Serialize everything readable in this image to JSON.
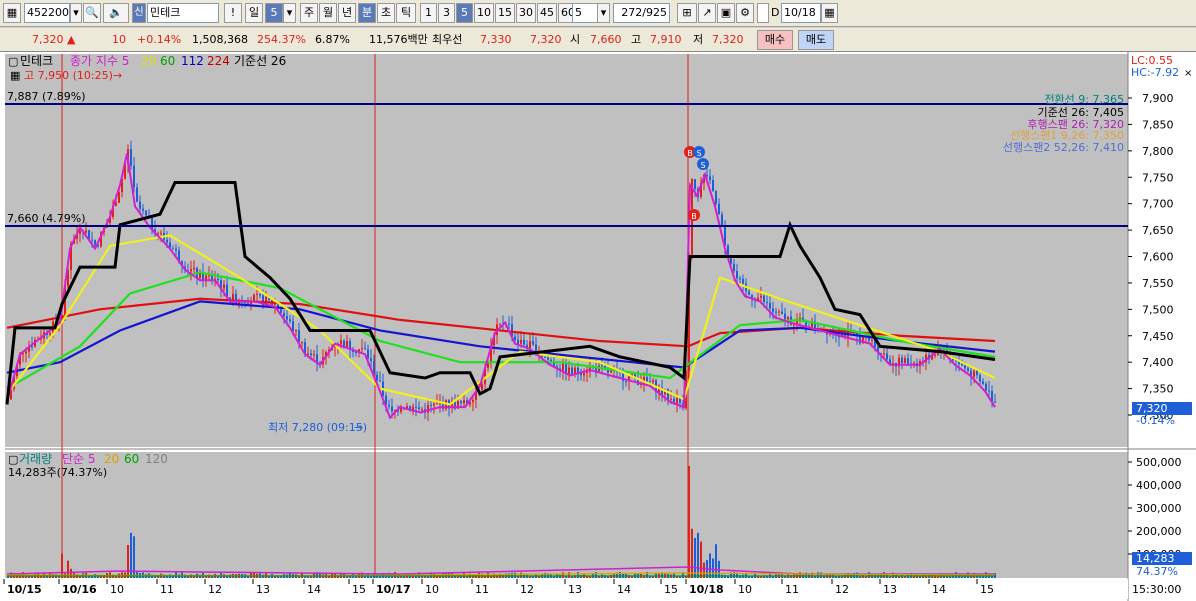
{
  "toolbar": {
    "code": "452200",
    "name": "민테크",
    "shin": "신",
    "btn_excl": "!",
    "period": "일",
    "period_n": "5",
    "week": "주",
    "month": "월",
    "year": "년",
    "minute": "분",
    "second": "초",
    "tick": "틱",
    "n1": "1",
    "n3": "3",
    "n5": "5",
    "n10": "10",
    "n15": "15",
    "n30": "30",
    "n45": "45",
    "n60": "60",
    "count": "5",
    "paging": "272/925",
    "chk_d": "D",
    "date": "10/18"
  },
  "quote": {
    "price": "7,320 ▲",
    "change": "10",
    "rate": "+0.14%",
    "volume": "1,508,368",
    "vol_ratio": "254.37%",
    "turnover": "6.87%",
    "amount": "11,576백만",
    "best_label": "최우선",
    "best_ask": "7,330",
    "best_bid": "7,320",
    "open_label": "시",
    "open": "7,660",
    "high_label": "고",
    "high": "7,910",
    "low_label": "저",
    "low": "7,320",
    "buy": "매수",
    "sell": "매도"
  },
  "legend": {
    "name": "민테크",
    "ma_label": "종가 지수 5",
    "ma20": "20",
    "ma60": "60",
    "ma112": "112",
    "ma224": "224",
    "base": "기준선 26",
    "high_mark": "고 7,950 (10:25)"
  },
  "lines": {
    "l1": "7,887 (7.89%)",
    "l2": "7,660 (4.79%)"
  },
  "lowmark": "최저 7,280 (09:15)",
  "ichimoku": {
    "conv": "전환선 9: 7,365",
    "base": "기준선 26: 7,405",
    "lag": "후행스팬 26: 7,320",
    "lead1": "선행스팬1 9,26: 7,350",
    "lead2": "선행스팬2 52,26: 7,410"
  },
  "lc": "LC:0.55",
  "hc": "HC:-7.92",
  "price_axis": [
    "7,900",
    "7,850",
    "7,800",
    "7,750",
    "7,700",
    "7,650",
    "7,600",
    "7,550",
    "7,500",
    "7,450",
    "7,400",
    "7,350",
    "7,300"
  ],
  "current": {
    "price": "7,320",
    "rate": "-0.14%"
  },
  "vol_legend": {
    "label": "거래량",
    "simple": "단순 5",
    "v20": "20",
    "v60": "60",
    "v120": "120",
    "value": "14,283주(74.37%)"
  },
  "vol_axis": [
    "500,000",
    "400,000",
    "300,000",
    "200,000",
    "100,000"
  ],
  "vol_current": {
    "value": "14,283",
    "rate": "74.37%"
  },
  "x_labels": [
    "10/15",
    "10/16",
    "10",
    "11",
    "12",
    "13",
    "14",
    "15",
    "10/17",
    "10",
    "11",
    "12",
    "13",
    "14",
    "15",
    "10/18",
    "10",
    "11",
    "12",
    "13",
    "14",
    "15"
  ],
  "time_label": "15:30:00",
  "colors": {
    "bg": "#c0c0c0",
    "up": "#e0201a",
    "down": "#1e5fd8",
    "ma5": "#d020d0",
    "ma20": "#f0f020",
    "ma60": "#20e020",
    "ma112": "#1515d0",
    "ma224": "#e01010",
    "base": "#000000"
  }
}
